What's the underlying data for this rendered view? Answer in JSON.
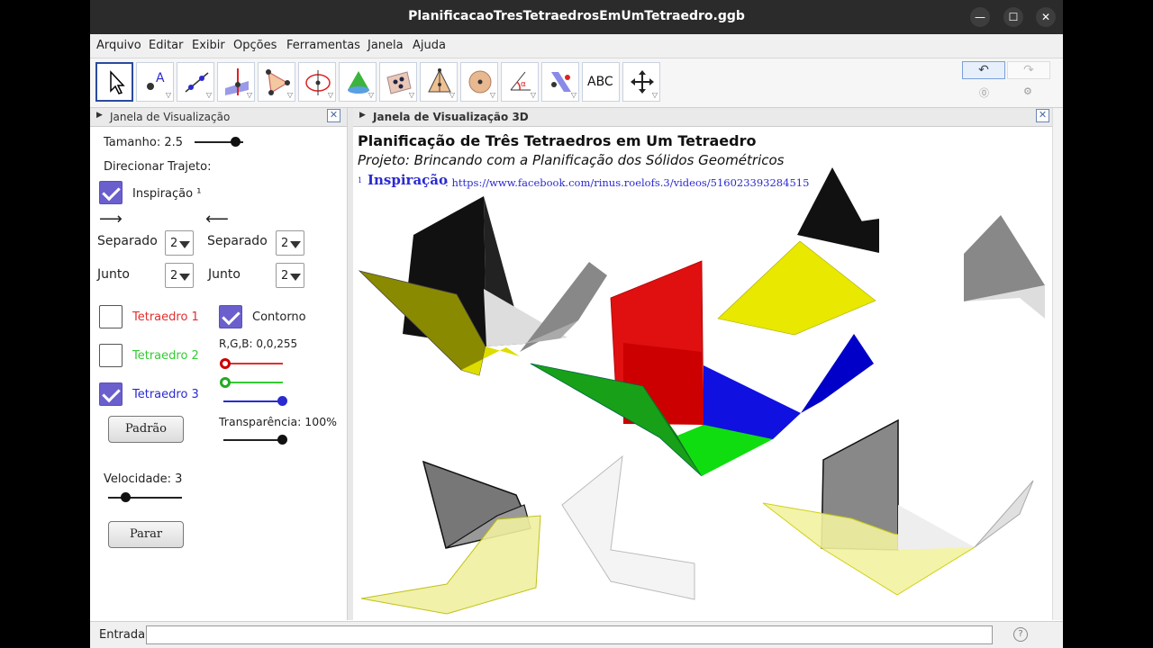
{
  "window": {
    "title": "PlanificacaoTresTetraedrosEmUmTetraedro.ggb"
  },
  "menu": [
    "Arquivo",
    "Editar",
    "Exibir",
    "Opções",
    "Ferramentas",
    "Janela",
    "Ajuda"
  ],
  "toolbar": {
    "tools": [
      "move-tool",
      "point-tool",
      "line-tool",
      "perpendicular-tool",
      "polygon-tool",
      "circle-tool",
      "pyramid-tool",
      "plane-tool",
      "net-tool",
      "sphere-tool",
      "angle-tool",
      "reflect-tool",
      "text-tool",
      "move-view-tool"
    ],
    "text_tool_label": "ABC",
    "undo": "↶",
    "redo": "↷"
  },
  "left_panel": {
    "header": "Janela de Visualização",
    "tamanho": "Tamanho: 2.5",
    "direcionar": "Direcionar Trajeto:",
    "inspiracao": "Inspiração ¹",
    "arrow_right": "⟶",
    "arrow_left": "⟵",
    "separado1": "Separado",
    "separado2": "Separado",
    "junto1": "Junto",
    "junto2": "Junto",
    "dd_value": "2",
    "tetra1": "Tetraedro 1",
    "tetra2": "Tetraedro 2",
    "tetra3": "Tetraedro 3",
    "contorno": "Contorno",
    "rgb": "R,G,B: 0,0,255",
    "transparencia": "Transparência: 100%",
    "padrao": "Padrão",
    "velocidade": "Velocidade: 3",
    "parar": "Parar",
    "colors": {
      "tetra1": "#e03030",
      "tetra2": "#33cc33",
      "tetra3": "#2a2ad0"
    }
  },
  "view3d": {
    "header": "Janela de Visualização 3D",
    "title": "Planificação de Três Tetraedros em Um Tetraedro",
    "subtitle": "Projeto: Brincando com a Planificação dos Sólidos Geométricos",
    "insp_sup": "1",
    "insp_label": "Inspiração",
    "insp_link": ": https://www.facebook.com/rinus.roelofs.3/videos/516023393284515"
  },
  "input_bar": {
    "label": "Entrada:",
    "value": ""
  }
}
